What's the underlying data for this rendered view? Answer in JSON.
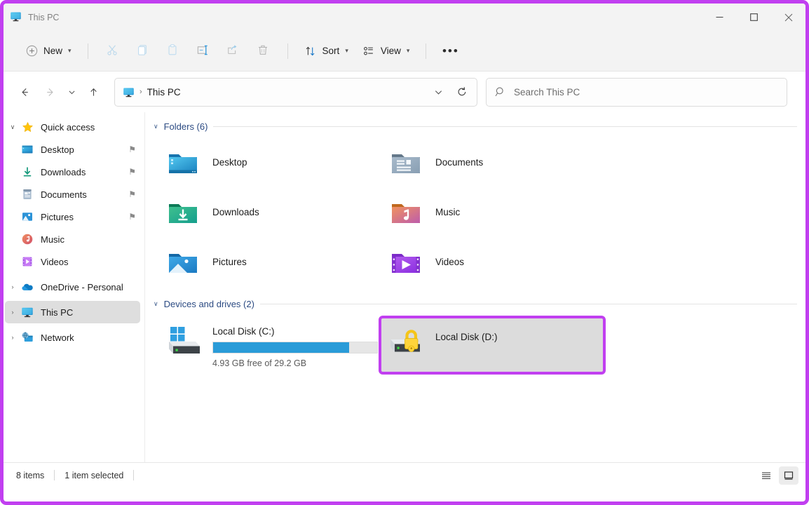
{
  "window": {
    "title": "This PC",
    "title_icon": "this-pc-monitor-icon",
    "highlight_color": "#c13ff0",
    "controls": [
      {
        "name": "minimize",
        "glyph": "—"
      },
      {
        "name": "maximize",
        "glyph": "☐"
      },
      {
        "name": "close",
        "glyph": "✕"
      }
    ]
  },
  "toolbar": {
    "new_label": "New",
    "new_icon": "plus-circle-icon",
    "cut_icon": "scissors-icon",
    "copy_icon": "copy-icon",
    "paste_icon": "clipboard-icon",
    "rename_icon": "rename-icon",
    "share_icon": "share-icon",
    "delete_icon": "trash-icon",
    "sort_label": "Sort",
    "sort_icon": "sort-arrows-icon",
    "view_label": "View",
    "view_icon": "view-list-icon",
    "more_label": "•••",
    "more_icon": "see-more-icon"
  },
  "address": {
    "back_icon": "back-arrow-icon",
    "forward_icon": "forward-arrow-icon",
    "recent_icon": "chevron-down-icon",
    "up_icon": "up-arrow-icon",
    "crumb_icon": "this-pc-monitor-icon",
    "crumb_text": "This PC",
    "crumb_separator": "›",
    "dropdown_icon": "chevron-down-icon",
    "refresh_icon": "refresh-icon"
  },
  "search": {
    "icon": "search-icon",
    "placeholder": "Search This PC",
    "value": ""
  },
  "sidebar": {
    "items": [
      {
        "label": "Quick access",
        "icon": "star-icon",
        "expander": "∨",
        "indent": false,
        "pinned": false,
        "selected": false
      },
      {
        "label": "Desktop",
        "icon": "desktop-folder-icon",
        "expander": "",
        "indent": true,
        "pinned": true,
        "selected": false
      },
      {
        "label": "Downloads",
        "icon": "downloads-arrow-icon",
        "expander": "",
        "indent": true,
        "pinned": true,
        "selected": false
      },
      {
        "label": "Documents",
        "icon": "documents-icon",
        "expander": "",
        "indent": true,
        "pinned": true,
        "selected": false
      },
      {
        "label": "Pictures",
        "icon": "pictures-icon",
        "expander": "",
        "indent": true,
        "pinned": true,
        "selected": false
      },
      {
        "label": "Music",
        "icon": "music-icon",
        "expander": "",
        "indent": true,
        "pinned": false,
        "selected": false
      },
      {
        "label": "Videos",
        "icon": "videos-icon",
        "expander": "",
        "indent": true,
        "pinned": false,
        "selected": false
      },
      {
        "label": "OneDrive - Personal",
        "icon": "onedrive-cloud-icon",
        "expander": "›",
        "indent": false,
        "pinned": false,
        "selected": false
      },
      {
        "label": "This PC",
        "icon": "this-pc-monitor-icon",
        "expander": "›",
        "indent": false,
        "pinned": false,
        "selected": true
      },
      {
        "label": "Network",
        "icon": "network-icon",
        "expander": "›",
        "indent": false,
        "pinned": false,
        "selected": false
      }
    ],
    "pin_glyph": "⚑"
  },
  "content": {
    "groups": [
      {
        "title": "Folders (6)",
        "chevron": "∨",
        "items": [
          {
            "label": "Desktop",
            "icon": "desktop-folder-icon"
          },
          {
            "label": "Documents",
            "icon": "documents-folder-icon"
          },
          {
            "label": "Downloads",
            "icon": "downloads-folder-icon"
          },
          {
            "label": "Music",
            "icon": "music-folder-icon"
          },
          {
            "label": "Pictures",
            "icon": "pictures-folder-icon"
          },
          {
            "label": "Videos",
            "icon": "videos-folder-icon"
          }
        ]
      }
    ],
    "drives_group": {
      "title": "Devices and drives (2)",
      "chevron": "∨"
    },
    "drives": [
      {
        "name": "Local Disk (C:)",
        "icon": "hdd-windows-icon",
        "free_text": "4.93 GB free of 29.2 GB",
        "used_percent": 83,
        "has_bar": true,
        "locked": false,
        "selected": false,
        "highlighted": false
      },
      {
        "name": "Local Disk (D:)",
        "icon": "hdd-locked-icon",
        "free_text": "",
        "used_percent": 0,
        "has_bar": false,
        "locked": true,
        "selected": true,
        "highlighted": true
      }
    ]
  },
  "statusbar": {
    "items_count": "8 items",
    "selection": "1 item selected",
    "details_view_icon": "details-view-icon",
    "large_icons_view_icon": "large-icons-view-icon"
  }
}
